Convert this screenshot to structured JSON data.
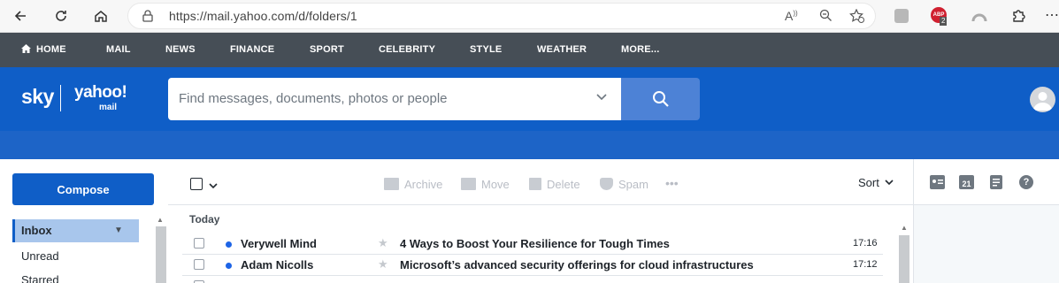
{
  "browser": {
    "url": "https://mail.yahoo.com/d/folders/1",
    "badge_count": "2",
    "badge_label": "ABP"
  },
  "nav": {
    "items": [
      "HOME",
      "MAIL",
      "NEWS",
      "FINANCE",
      "SPORT",
      "CELEBRITY",
      "STYLE",
      "WEATHER",
      "MORE..."
    ]
  },
  "header": {
    "logo_sky": "sky",
    "logo_yahoo": "yahoo!",
    "logo_mail": "mail",
    "search_placeholder": "Find messages, documents, photos or people"
  },
  "sidebar": {
    "compose_label": "Compose",
    "folders": [
      "Inbox",
      "Unread",
      "Starred"
    ]
  },
  "toolbar": {
    "archive": "Archive",
    "move": "Move",
    "delete": "Delete",
    "spam": "Spam",
    "more": "•••",
    "sort": "Sort"
  },
  "mail": {
    "group_label": "Today",
    "rows": [
      {
        "from": "Verywell Mind",
        "subject": "4 Ways to Boost Your Resilience for Tough Times",
        "time": "17:16",
        "unread": true
      },
      {
        "from": "Adam Nicolls",
        "subject": "Microsoft’s advanced security offerings for cloud infrastructures",
        "time": "17:12",
        "unread": true
      }
    ]
  },
  "rail": {
    "calendar_day": "21"
  },
  "colors": {
    "brand_blue": "#0f5ec7",
    "nav_gray": "#464e56",
    "unread_dot": "#1d64e6"
  }
}
